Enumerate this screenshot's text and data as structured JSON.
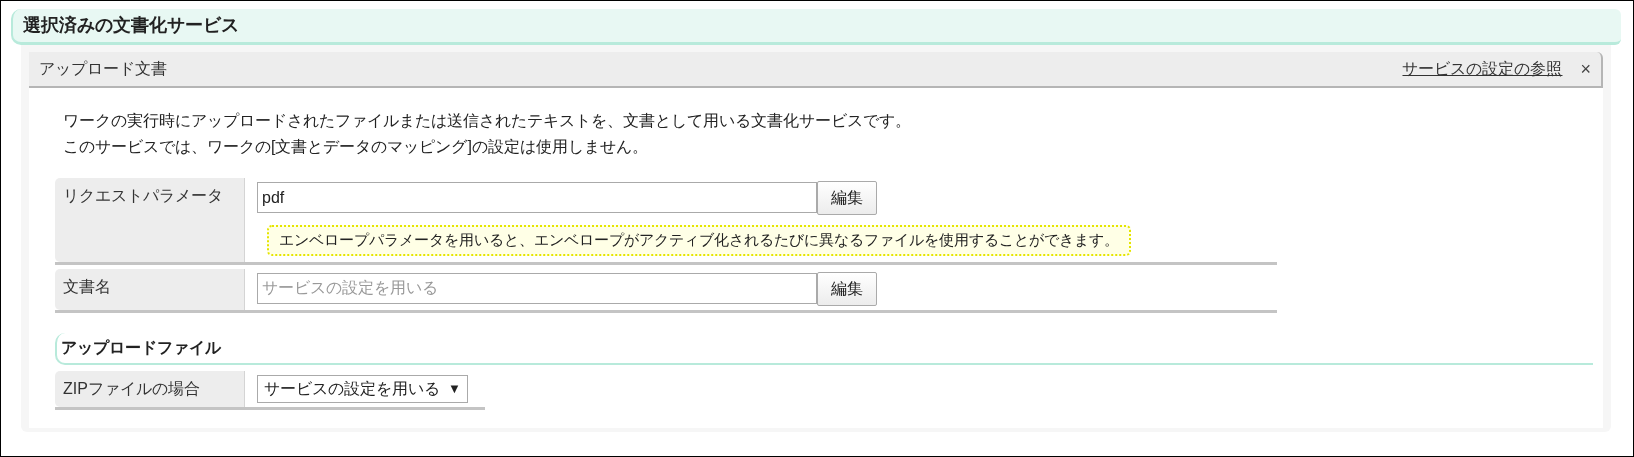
{
  "section_title": "選択済みの文書化サービス",
  "panel": {
    "title": "アップロード文書",
    "settings_link": "サービスの設定の参照",
    "close": "×",
    "description": [
      "ワークの実行時にアップロードされたファイルまたは送信されたテキストを、文書として用いる文書化サービスです。",
      "このサービスでは、ワークの[文書とデータのマッピング]の設定は使用しません。"
    ],
    "fields": [
      {
        "label": "リクエストパラメータ",
        "value": "pdf",
        "button": "編集",
        "hint": "エンベロープパラメータを用いると、エンベロープがアクティブ化されるたびに異なるファイルを使用することができます。"
      },
      {
        "label": "文書名",
        "placeholder": "サービスの設定を用いる",
        "button": "編集"
      }
    ],
    "subsection_title": "アップロードファイル",
    "select_rows": [
      {
        "label": "ZIPファイルの場合",
        "value": "サービスの設定を用いる",
        "arrow": "▼"
      }
    ]
  }
}
